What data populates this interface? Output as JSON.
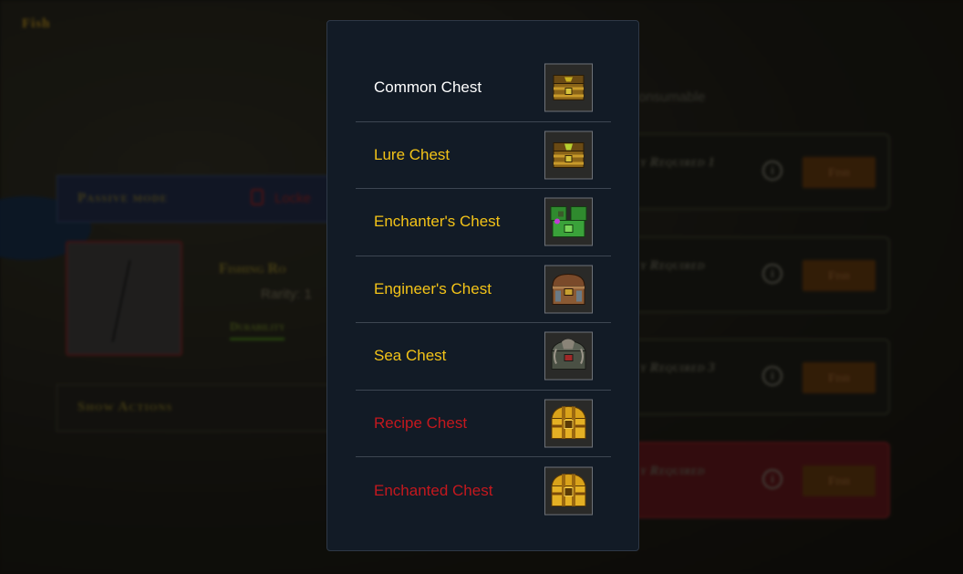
{
  "background": {
    "title": "Fish",
    "passive_mode_label": "Passive mode",
    "locked_label": "Locke",
    "rod_name": "Fishing Ro",
    "rarity_label": "Rarity: 1",
    "durability_label": "Durability",
    "show_actions_label": "Show Actions",
    "consumable_text": "onsumable",
    "zones": [
      {
        "requirement": "y Required 1",
        "fish_label": "Fish",
        "highlight": false
      },
      {
        "requirement": "y Required",
        "fish_label": "Fish",
        "highlight": false
      },
      {
        "requirement": "y Required 3",
        "fish_label": "Fish",
        "highlight": false
      },
      {
        "requirement": "y Required",
        "fish_label": "Fish",
        "highlight": true
      }
    ]
  },
  "modal": {
    "chests": [
      {
        "name": "Common Chest",
        "status": "owned",
        "icon": "common-chest-icon"
      },
      {
        "name": "Lure Chest",
        "status": "available",
        "icon": "lure-chest-icon"
      },
      {
        "name": "Enchanter's Chest",
        "status": "available",
        "icon": "enchanters-chest-icon"
      },
      {
        "name": "Engineer's Chest",
        "status": "available",
        "icon": "engineers-chest-icon"
      },
      {
        "name": "Sea Chest",
        "status": "available",
        "icon": "sea-chest-icon"
      },
      {
        "name": "Recipe Chest",
        "status": "locked",
        "icon": "recipe-chest-icon"
      },
      {
        "name": "Enchanted Chest",
        "status": "locked",
        "icon": "enchanted-chest-icon"
      }
    ]
  },
  "colors": {
    "modal_bg": "#121b26",
    "owned_text": "#ffffff",
    "available_text": "#f3c318",
    "locked_text": "#c4181e",
    "divider": "#3d4652"
  }
}
